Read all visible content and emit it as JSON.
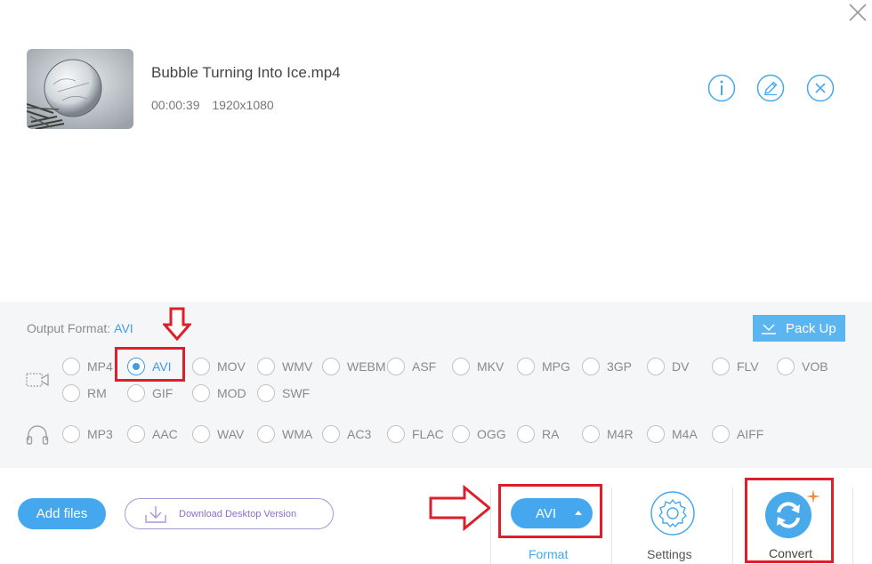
{
  "window": {
    "close_icon": "close-icon"
  },
  "file": {
    "name": "Bubble Turning Into Ice.mp4",
    "duration": "00:00:39",
    "resolution": "1920x1080",
    "thumbnail_icon": "video-thumbnail",
    "actions": [
      "info-icon",
      "edit-icon",
      "remove-icon"
    ]
  },
  "output": {
    "label": "Output Format:",
    "value": "AVI",
    "pack_up_label": "Pack Up",
    "video_formats": [
      "MP4",
      "AVI",
      "MOV",
      "WMV",
      "WEBM",
      "ASF",
      "MKV",
      "MPG",
      "3GP",
      "DV",
      "FLV",
      "VOB",
      "RM",
      "GIF",
      "MOD",
      "SWF"
    ],
    "audio_formats": [
      "MP3",
      "AAC",
      "WAV",
      "WMA",
      "AC3",
      "FLAC",
      "OGG",
      "RA",
      "M4R",
      "M4A",
      "AIFF"
    ],
    "selected": "AVI"
  },
  "bottom": {
    "add_files_label": "Add files",
    "download_label": "Download Desktop Version",
    "format_pill_value": "AVI",
    "format_label": "Format",
    "settings_label": "Settings",
    "convert_label": "Convert"
  },
  "colors": {
    "accent": "#45a8ef",
    "annotation_red": "#dd1f2b",
    "panel_bg": "#f5f6f8",
    "download_purple": "#8a6fcf"
  }
}
